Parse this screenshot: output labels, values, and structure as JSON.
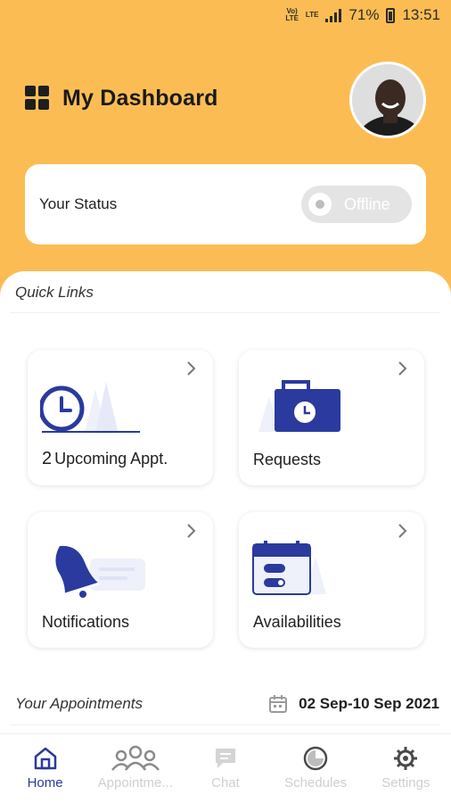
{
  "status_bar": {
    "network_1": "Vo) LTE",
    "network_2": "LTE",
    "battery": "71%",
    "time": "13:51"
  },
  "header": {
    "title": "My Dashboard",
    "icon": "dashboard-icon",
    "avatar": "profile-photo"
  },
  "status_card": {
    "label": "Your Status",
    "toggle_text": "Offline"
  },
  "quick_links": {
    "title": "Quick Links",
    "tiles": [
      {
        "count": "2",
        "label": "Upcoming Appt.",
        "icon": "clock-icon"
      },
      {
        "label": "Requests",
        "icon": "briefcase-icon"
      },
      {
        "label": "Notifications",
        "icon": "bell-icon"
      },
      {
        "label": "Availabilities",
        "icon": "calendar-icon"
      }
    ]
  },
  "appointments": {
    "title": "Your Appointments",
    "date_range": "02 Sep-10 Sep 2021"
  },
  "nav": {
    "items": [
      {
        "label": "Home",
        "icon": "home-icon",
        "active": true
      },
      {
        "label": "Appointme...",
        "icon": "users-icon"
      },
      {
        "label": "Chat",
        "icon": "chat-icon"
      },
      {
        "label": "Schedules",
        "icon": "schedule-icon"
      },
      {
        "label": "Settings",
        "icon": "gear-icon"
      }
    ]
  },
  "colors": {
    "accent": "#FBBD53",
    "primary": "#2A3A9E",
    "inactive": "#CFCFCF"
  }
}
